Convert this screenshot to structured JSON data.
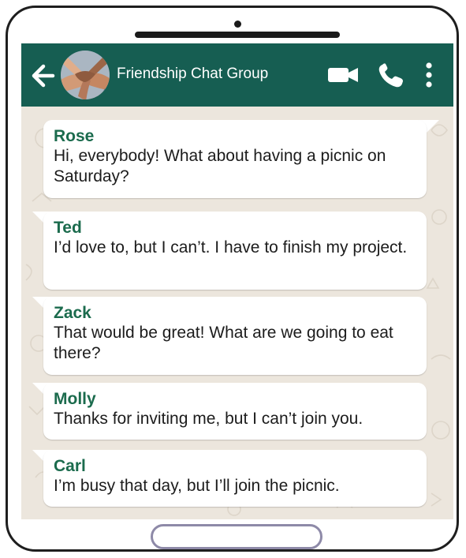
{
  "chat": {
    "title": "Friendship Chat Group",
    "icons": {
      "back": "arrow-left-icon",
      "avatar": "group-hands-avatar",
      "video": "video-camera-icon",
      "call": "phone-icon",
      "menu": "vertical-dots-icon"
    }
  },
  "colors": {
    "header": "#165e52",
    "sender_name": "#1b6b4d",
    "wallpaper": "#ece6dd",
    "bubble": "#ffffff"
  },
  "messages": [
    {
      "sender": "Rose",
      "text": "Hi, everybody! What about having a picnic on Saturday?"
    },
    {
      "sender": "Ted",
      "text": "I’d love to, but I can’t. I have to finish my project."
    },
    {
      "sender": "Zack",
      "text": "That would be great! What are we going to eat there?"
    },
    {
      "sender": "Molly",
      "text": "Thanks for inviting me, but I can’t join you."
    },
    {
      "sender": "Carl",
      "text": "I’m busy that day, but I’ll join the picnic."
    }
  ]
}
